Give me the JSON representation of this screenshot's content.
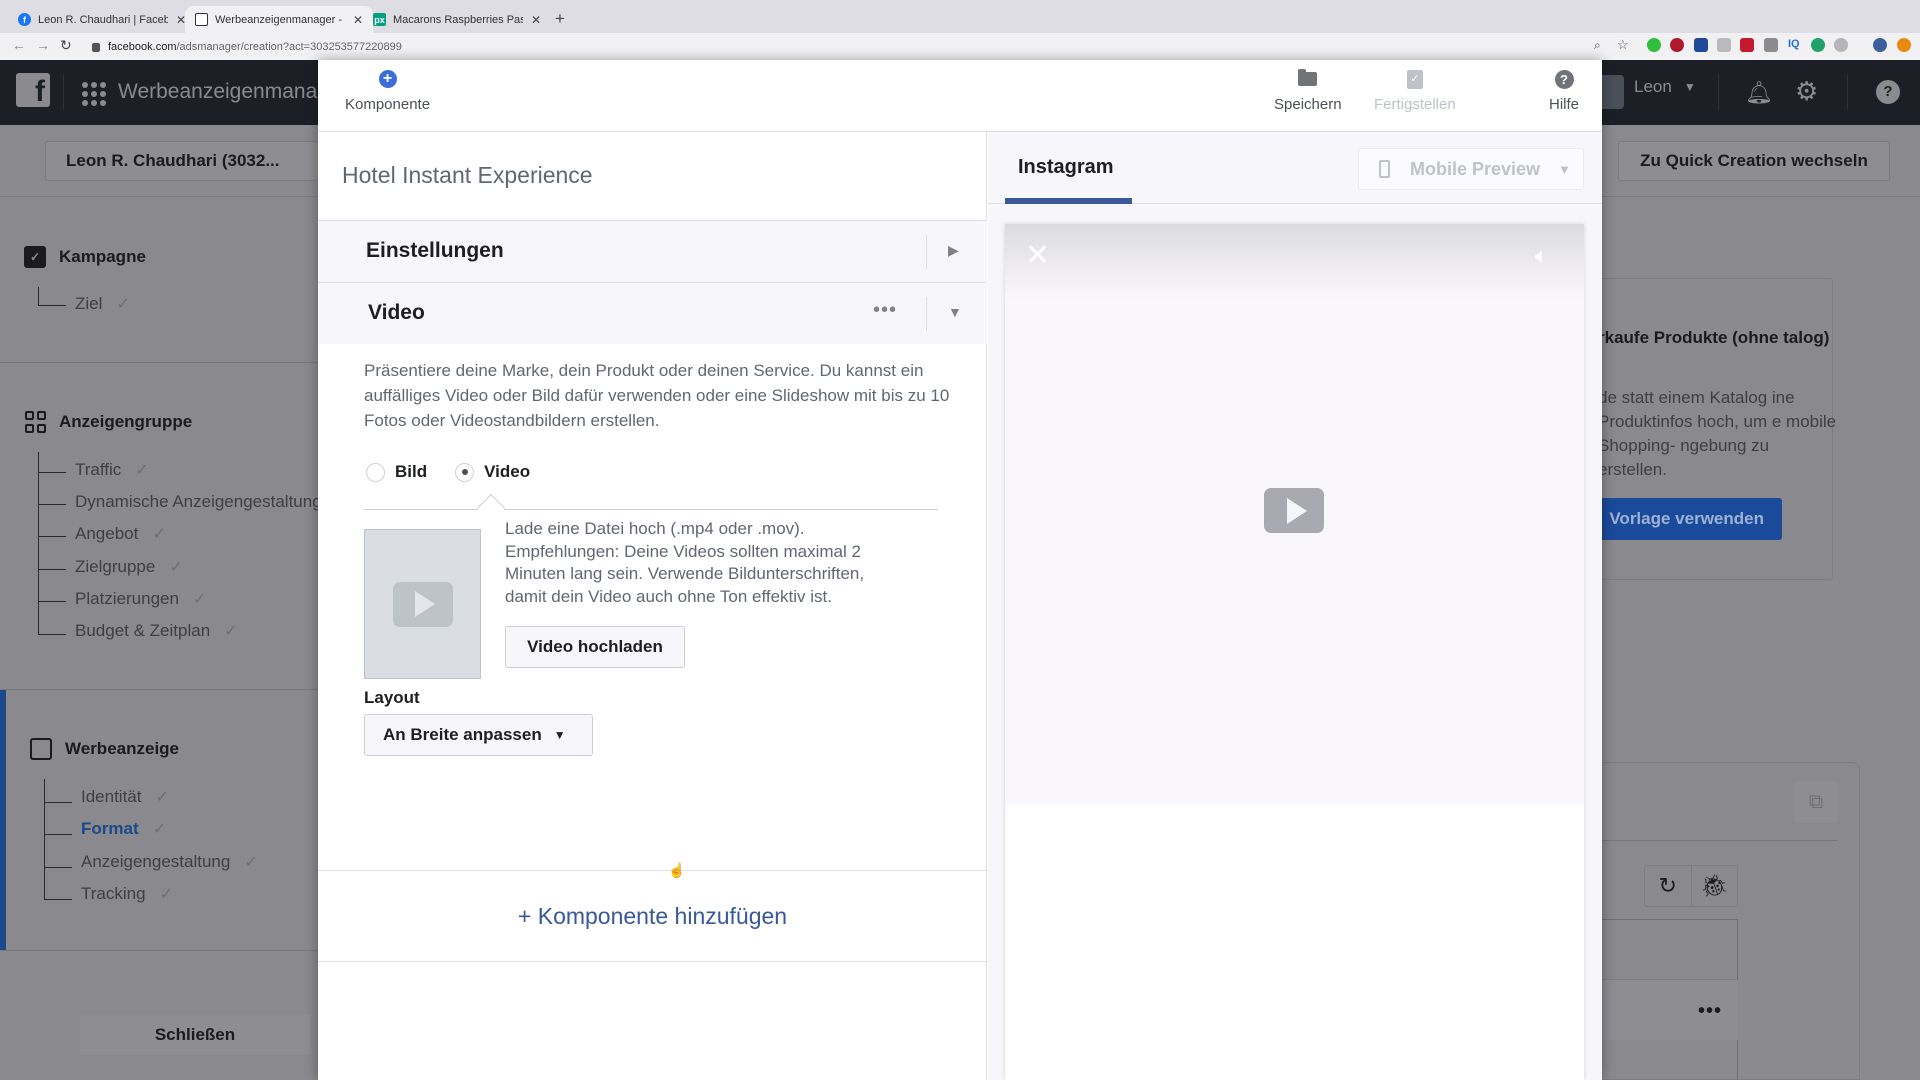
{
  "browser": {
    "tabs": [
      {
        "title": "Leon R. Chaudhari | Facebook",
        "favicon": "facebook-icon",
        "color": "#1877f2",
        "active": false
      },
      {
        "title": "Werbeanzeigenmanager - Creat",
        "favicon": "adsmanager-icon",
        "color": "#333333",
        "active": true
      },
      {
        "title": "Macarons Raspberries Pastries",
        "favicon": "pexels-icon",
        "color": "#05a081",
        "active": false
      }
    ],
    "url_host": "facebook.com",
    "url_path": "/adsmanager/creation?act=303253577220899"
  },
  "app": {
    "title": "Werbeanzeigenmanager",
    "user": "Leon",
    "account_selector": "Leon R. Chaudhari (3032...",
    "quick_creation_button": "Zu Quick Creation wechseln",
    "close_button": "Schließen"
  },
  "sidebar": {
    "sections": [
      {
        "title": "Kampagne",
        "icon": "campaign-folder-icon",
        "items": [
          {
            "label": "Ziel",
            "done": true
          }
        ]
      },
      {
        "title": "Anzeigengruppe",
        "icon": "adset-grid-icon",
        "items": [
          {
            "label": "Traffic",
            "done": true
          },
          {
            "label": "Dynamische Anzeigengestaltung",
            "done": false
          },
          {
            "label": "Angebot",
            "done": true
          },
          {
            "label": "Zielgruppe",
            "done": true
          },
          {
            "label": "Platzierungen",
            "done": true
          },
          {
            "label": "Budget & Zeitplan",
            "done": true
          }
        ]
      },
      {
        "title": "Werbeanzeige",
        "icon": "ad-tablet-icon",
        "items": [
          {
            "label": "Identität",
            "done": true
          },
          {
            "label": "Format",
            "done": true,
            "current": true
          },
          {
            "label": "Anzeigengestaltung",
            "done": true
          },
          {
            "label": "Tracking",
            "done": true
          }
        ]
      }
    ],
    "check_glyph": "✓"
  },
  "background_card": {
    "title": "rkaufe Produkte (ohne talog)",
    "text": "de statt einem Katalog ine Produktinfos hoch, um e mobile Shopping- ngebung zu erstellen.",
    "button": "Vorlage verwenden"
  },
  "modal": {
    "toolbar": {
      "component": "Komponente",
      "save": "Speichern",
      "finish": "Fertigstellen",
      "help": "Hilfe"
    },
    "canvas_title": "Hotel Instant Experience",
    "sections": {
      "settings": "Einstellungen",
      "video": "Video"
    },
    "video": {
      "description": "Präsentiere deine Marke, dein Produkt oder deinen Service. Du kannst ein auffälliges Video oder Bild dafür verwenden oder eine Slideshow mit bis zu 10 Fotos oder Videostandbildern erstellen.",
      "media_options": [
        {
          "label": "Bild",
          "selected": false
        },
        {
          "label": "Video",
          "selected": true
        }
      ],
      "upload_hint": "Lade eine Datei hoch (.mp4 oder .mov). Empfehlungen: Deine Videos sollten maximal 2 Minuten lang sein. Verwende Bildunterschriften, damit dein Video auch ohne Ton effektiv ist.",
      "upload_button": "Video hochladen",
      "layout_label": "Layout",
      "layout_value": "An Breite anpassen"
    },
    "add_component": "+ Komponente hinzufügen",
    "preview": {
      "tab": "Instagram",
      "device_selector": "Mobile Preview"
    }
  },
  "colors": {
    "accent_blue": "#385898",
    "tab_indicator": "#3c5a9a",
    "plus_icon": "#3b6ed8"
  }
}
